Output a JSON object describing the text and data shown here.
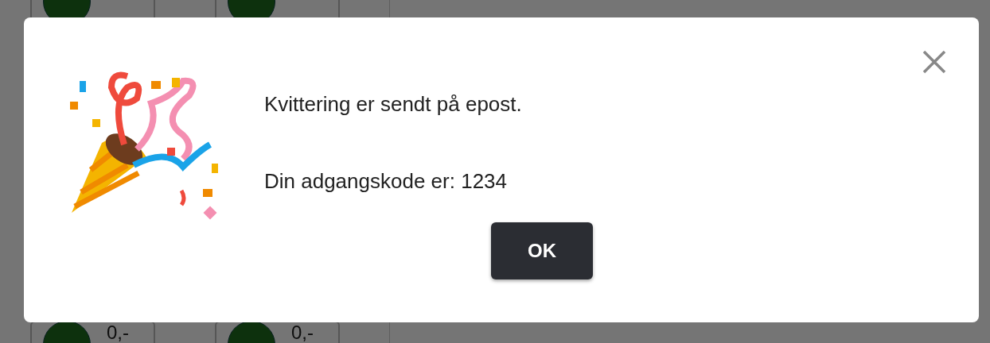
{
  "background": {
    "tiles_top": [
      {
        "kind": "product"
      },
      {
        "kind": "product"
      }
    ],
    "tiles_bottom": [
      {
        "price": "0,-"
      },
      {
        "price": "0,-"
      }
    ]
  },
  "dialog": {
    "messages": [
      "Kvittering er sendt på epost.",
      "Din adgangskode er: 1234"
    ],
    "button": "OK"
  }
}
